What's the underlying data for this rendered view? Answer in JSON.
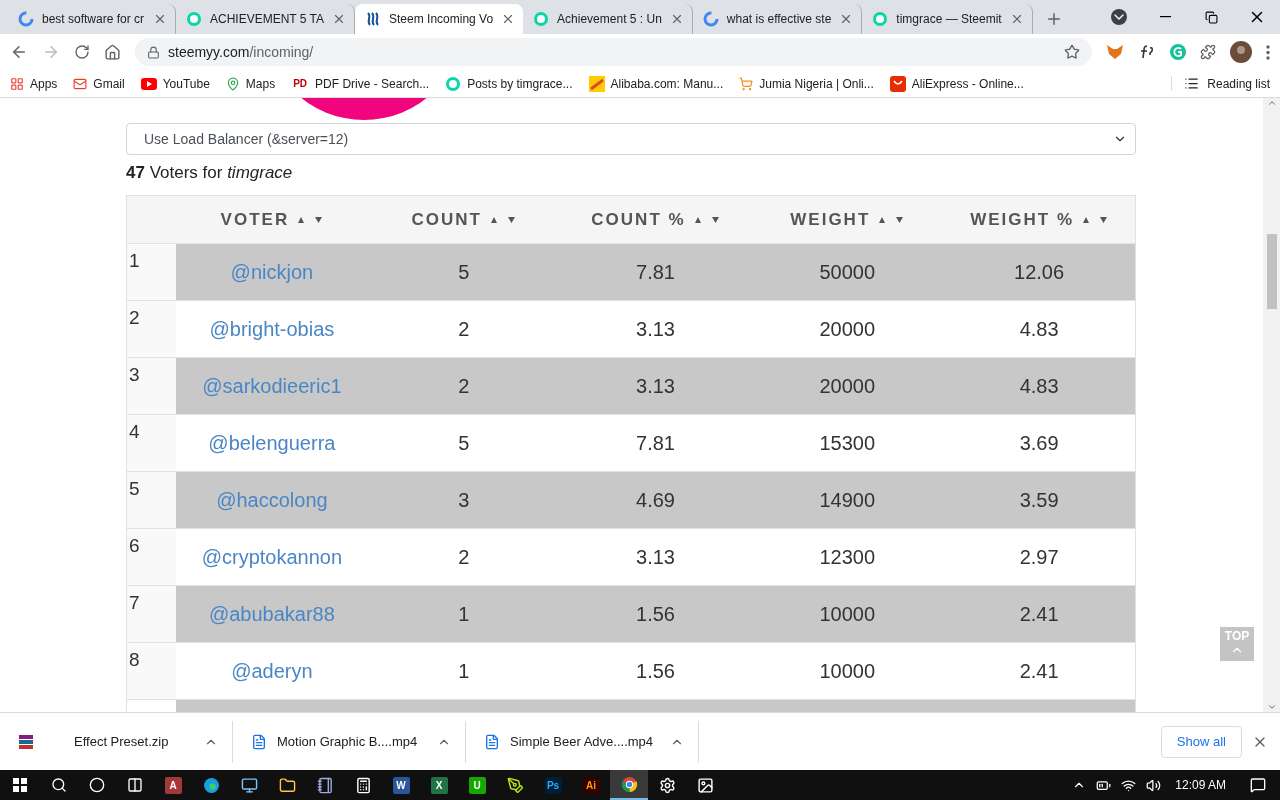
{
  "tabs": [
    {
      "title": "best software for cr",
      "kind": "google",
      "selected": false
    },
    {
      "title": "ACHIEVEMENT 5 TA",
      "kind": "steemit",
      "selected": false
    },
    {
      "title": "Steem Incoming Vo",
      "kind": "steem",
      "selected": true
    },
    {
      "title": "Achievement 5 : Un",
      "kind": "steemit",
      "selected": false
    },
    {
      "title": "what is effective ste",
      "kind": "google",
      "selected": false
    },
    {
      "title": "timgrace — Steemit",
      "kind": "steemit",
      "selected": false
    }
  ],
  "address": {
    "host": "steemyy.com",
    "path": "/incoming/"
  },
  "bookmarks": [
    {
      "label": "Apps",
      "kind": "apps"
    },
    {
      "label": "Gmail",
      "kind": "gmail"
    },
    {
      "label": "YouTube",
      "kind": "youtube"
    },
    {
      "label": "Maps",
      "kind": "maps"
    },
    {
      "label": "PDF Drive - Search...",
      "kind": "pdf",
      "glyph": "PD"
    },
    {
      "label": "Posts by timgrace...",
      "kind": "steemit"
    },
    {
      "label": "Alibaba.com: Manu...",
      "kind": "alibaba"
    },
    {
      "label": "Jumia Nigeria | Onli...",
      "kind": "cart"
    },
    {
      "label": "AliExpress - Online...",
      "kind": "aliexpress"
    }
  ],
  "reading_list": "Reading list",
  "server_select": {
    "value": "Use Load Balancer (&server=12)"
  },
  "summary": "**47** Voters for *timgrace*",
  "table": {
    "columns": [
      "VOTER",
      "COUNT",
      "COUNT %",
      "WEIGHT",
      "WEIGHT %"
    ],
    "rows": [
      {
        "rank": "1",
        "voter": "@nickjon",
        "count": "5",
        "count_pct": "7.81",
        "weight": "50000",
        "weight_pct": "12.06"
      },
      {
        "rank": "2",
        "voter": "@bright-obias",
        "count": "2",
        "count_pct": "3.13",
        "weight": "20000",
        "weight_pct": "4.83"
      },
      {
        "rank": "3",
        "voter": "@sarkodieeric1",
        "count": "2",
        "count_pct": "3.13",
        "weight": "20000",
        "weight_pct": "4.83"
      },
      {
        "rank": "4",
        "voter": "@belenguerra",
        "count": "5",
        "count_pct": "7.81",
        "weight": "15300",
        "weight_pct": "3.69"
      },
      {
        "rank": "5",
        "voter": "@haccolong",
        "count": "3",
        "count_pct": "4.69",
        "weight": "14900",
        "weight_pct": "3.59"
      },
      {
        "rank": "6",
        "voter": "@cryptokannon",
        "count": "2",
        "count_pct": "3.13",
        "weight": "12300",
        "weight_pct": "2.97"
      },
      {
        "rank": "7",
        "voter": "@abubakar88",
        "count": "1",
        "count_pct": "1.56",
        "weight": "10000",
        "weight_pct": "2.41"
      },
      {
        "rank": "8",
        "voter": "@aderyn",
        "count": "1",
        "count_pct": "1.56",
        "weight": "10000",
        "weight_pct": "2.41"
      }
    ]
  },
  "top_button": "TOP",
  "downloads": [
    {
      "name": "Effect Preset.zip",
      "kind": "archive"
    },
    {
      "name": "Motion Graphic B....mp4",
      "kind": "file"
    },
    {
      "name": "Simple Beer Adve....mp4",
      "kind": "file"
    }
  ],
  "show_all": "Show all",
  "taskbar": {
    "apps": [
      {
        "kind": "taskview"
      },
      {
        "kind": "access",
        "glyph": "A"
      },
      {
        "kind": "edge"
      },
      {
        "kind": "monitor"
      },
      {
        "kind": "folder"
      },
      {
        "kind": "notepad"
      },
      {
        "kind": "calculator"
      },
      {
        "kind": "word",
        "glyph": "W"
      },
      {
        "kind": "excel",
        "glyph": "X"
      },
      {
        "kind": "upwork",
        "glyph": "U"
      },
      {
        "kind": "pen"
      },
      {
        "kind": "photoshop",
        "glyph": "Ps"
      },
      {
        "kind": "illustrator",
        "glyph": "Ai"
      },
      {
        "kind": "chrome",
        "selected": true
      },
      {
        "kind": "settings"
      },
      {
        "kind": "photos"
      }
    ],
    "time": "12:09 AM"
  }
}
